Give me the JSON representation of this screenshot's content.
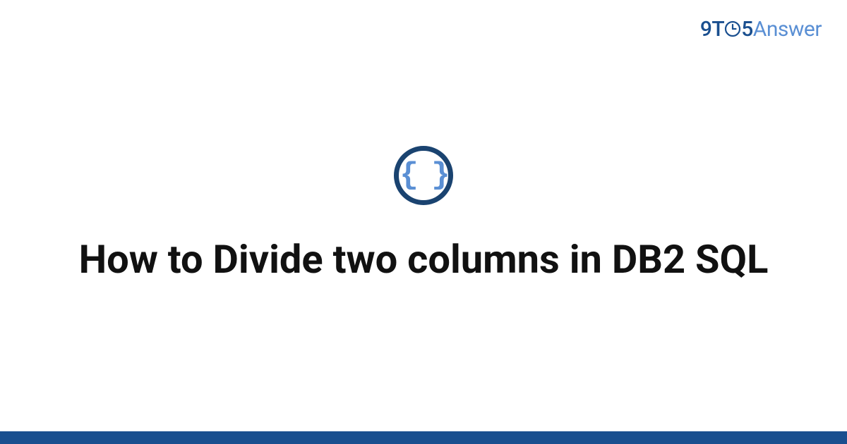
{
  "brand": {
    "prefix": "9T",
    "middle": "5",
    "suffix": "Answer"
  },
  "icon": {
    "glyph": "{ }"
  },
  "title": "How to Divide two columns in DB2 SQL"
}
